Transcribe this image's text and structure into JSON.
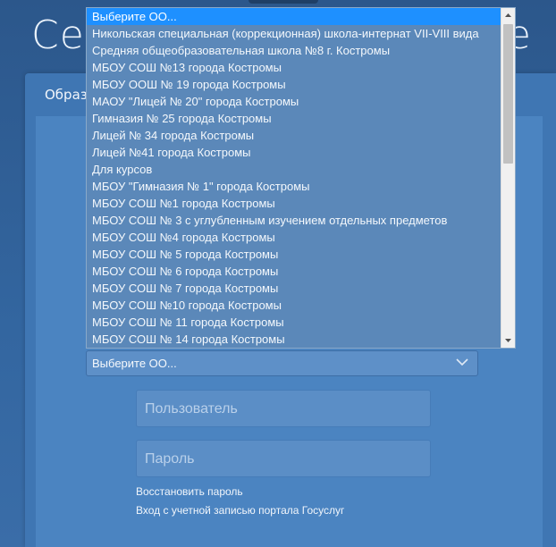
{
  "background": {
    "title_left": "Сет",
    "title_right": "е"
  },
  "card": {
    "tab_label": "Образ"
  },
  "school_select": {
    "value": "Выберите ОО...",
    "options": [
      "Выберите ОО...",
      "Никольская специальная (коррекционная) школа-интернат VII-VIII вида",
      "Средняя общеобразовательная школа №8 г. Костромы",
      "МБОУ СОШ №13 города Костромы",
      "МБОУ ООШ № 19 города Костромы",
      "МАОУ \"Лицей № 20\" города Костромы",
      "Гимназия № 25 города Костромы",
      "Лицей № 34 города Костромы",
      "Лицей №41 города Костромы",
      "Для курсов",
      "МБОУ \"Гимназия № 1\" города Костромы",
      "МБОУ СОШ №1 города Костромы",
      "МБОУ СОШ № 3 с углубленным изучением отдельных предметов",
      "МБОУ СОШ №4 города Костромы",
      "МБОУ СОШ № 5 города Костромы",
      "МБОУ СОШ № 6 города Костромы",
      "МБОУ СОШ № 7 города Костромы",
      "МБОУ СОШ №10 города Костромы",
      "МБОУ СОШ № 11 города Костромы",
      "МБОУ СОШ № 14 города Костромы"
    ]
  },
  "login": {
    "user_placeholder": "Пользователь",
    "password_placeholder": "Пароль",
    "restore_link": "Восстановить пароль",
    "gosuslugi_link": "Вход с учетной записью портала Госуслуг"
  },
  "colors": {
    "selected_option": "#1e90ff",
    "dropdown_bg": "#5b88b9",
    "page_bg": "#2f5b8f"
  },
  "icons": {
    "select_chevron": "chevron-down-icon",
    "scroll_up": "triangle-up-icon",
    "scroll_down": "triangle-down-icon"
  }
}
